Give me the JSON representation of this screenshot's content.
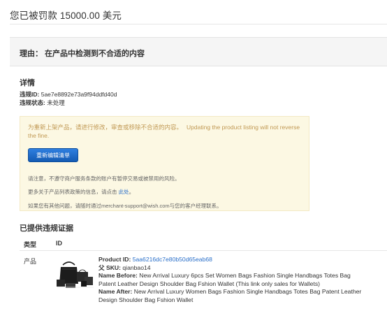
{
  "header": {
    "title": "您已被罚款 15000.00 美元"
  },
  "reason": {
    "text": "理由： 在产品中检测到不合适的内容"
  },
  "details": {
    "heading": "详情",
    "violation_id_label": "违规ID:",
    "violation_id": "5ae7e8892e73a9f94ddfd40d",
    "status_label": "违规状态:",
    "status": "未处理"
  },
  "notice": {
    "warning_cn": "为重新上架产品，请进行修改，审查或移除不合适的内容。",
    "warning_en": "Updating the product listing will not reverse the fine.",
    "relist_button": "重新编辑清单",
    "line1": "请注意，不遵守商户服务条款的账户有暂停交易或被禁用的风险。",
    "line2_prefix": "更多关于产品列表政策的信息，请点击",
    "line2_link": "此处",
    "line2_suffix": "。",
    "line3": "如果您有其他问题，请随时通过merchant-support@wish.com与您的客户经理联系。"
  },
  "evidence": {
    "heading": "已提供违规证据",
    "columns": [
      "类型",
      "ID"
    ],
    "rows": [
      {
        "type": "产品",
        "product_id_label": "Product ID:",
        "product_id": "5aa6216dc7e80b50d65eab68",
        "sku_label": "父 SKU:",
        "sku": "qianbao14",
        "name_before_label": "Name Before:",
        "name_before": "New Arrival Luxury 6pcs Set Women Bags Fashion Single Handbags Totes Bag Patent Leather Design Shoulder Bag Fshion Wallet (This link only sales for Wallets)",
        "name_after_label": "Name After:",
        "name_after": "New Arrival Luxury Women Bags Fashion Single Handbags Totes Bag Patent Leather Design Shoulder Bag Fshion Wallet"
      }
    ]
  },
  "colors": {
    "link": "#2a6fc9",
    "warning_text": "#c09853",
    "warning_bg": "#fcf8e3",
    "button": "#1a6ac9"
  }
}
